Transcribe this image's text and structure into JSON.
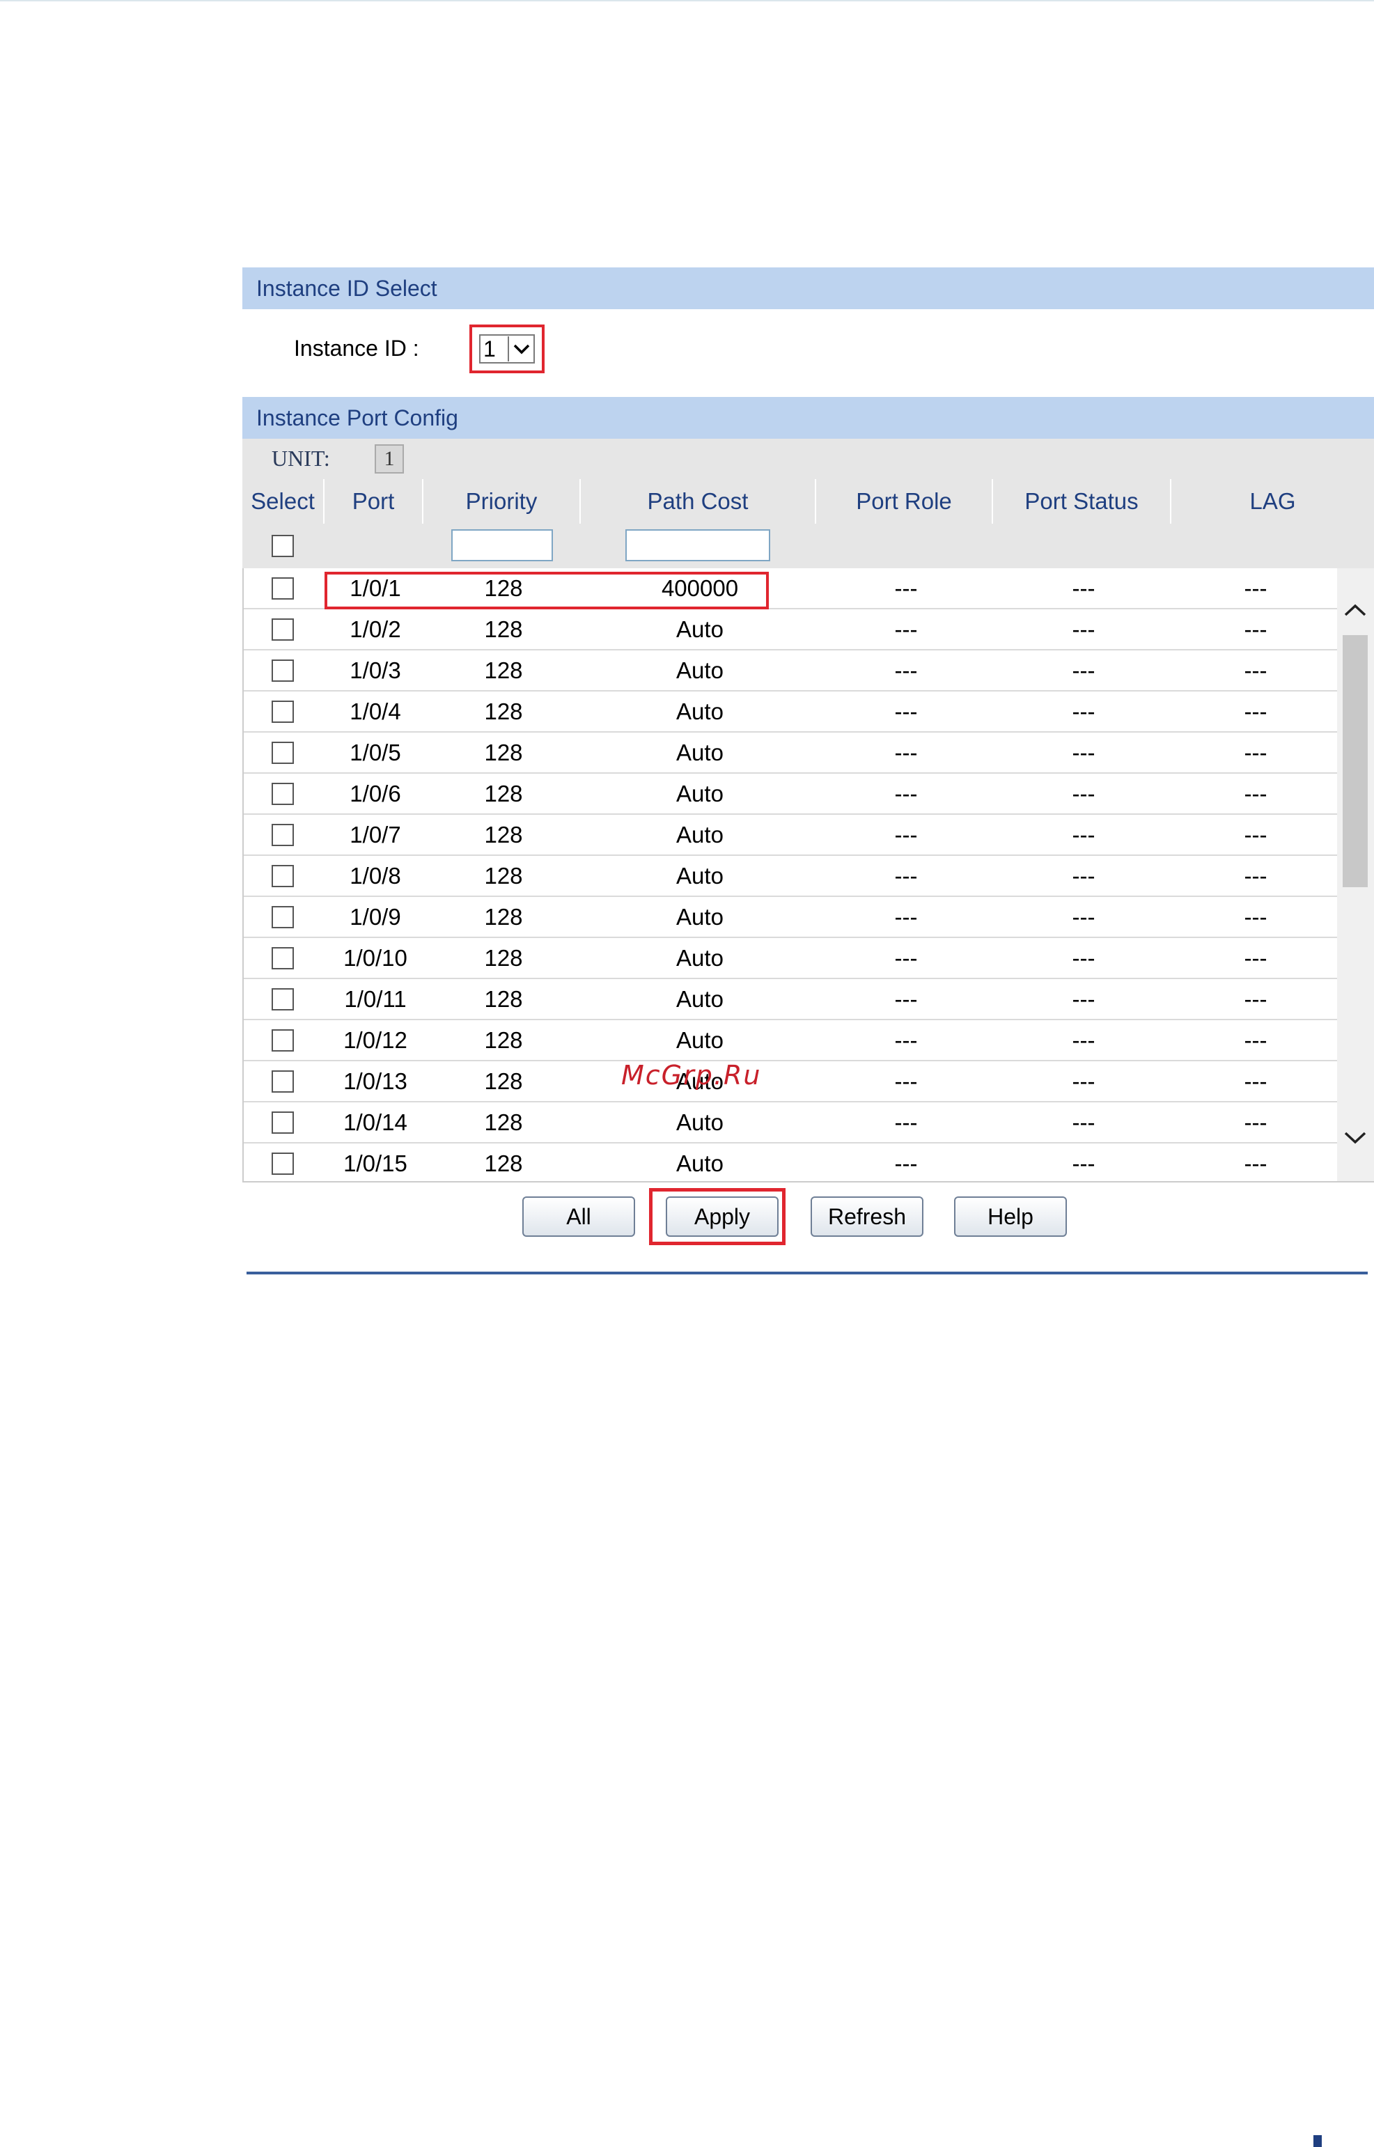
{
  "sections": {
    "instance_id_select": "Instance ID Select",
    "instance_port_config": "Instance Port Config"
  },
  "instance": {
    "label": "Instance ID :",
    "value": "1"
  },
  "unit": {
    "label": "UNIT:",
    "value": "1"
  },
  "columns": [
    "Select",
    "Port",
    "Priority",
    "Path Cost",
    "Port Role",
    "Port Status",
    "LAG"
  ],
  "rows": [
    {
      "port": "1/0/1",
      "priority": "128",
      "path_cost": "400000",
      "role": "---",
      "status": "---",
      "lag": "---"
    },
    {
      "port": "1/0/2",
      "priority": "128",
      "path_cost": "Auto",
      "role": "---",
      "status": "---",
      "lag": "---"
    },
    {
      "port": "1/0/3",
      "priority": "128",
      "path_cost": "Auto",
      "role": "---",
      "status": "---",
      "lag": "---"
    },
    {
      "port": "1/0/4",
      "priority": "128",
      "path_cost": "Auto",
      "role": "---",
      "status": "---",
      "lag": "---"
    },
    {
      "port": "1/0/5",
      "priority": "128",
      "path_cost": "Auto",
      "role": "---",
      "status": "---",
      "lag": "---"
    },
    {
      "port": "1/0/6",
      "priority": "128",
      "path_cost": "Auto",
      "role": "---",
      "status": "---",
      "lag": "---"
    },
    {
      "port": "1/0/7",
      "priority": "128",
      "path_cost": "Auto",
      "role": "---",
      "status": "---",
      "lag": "---"
    },
    {
      "port": "1/0/8",
      "priority": "128",
      "path_cost": "Auto",
      "role": "---",
      "status": "---",
      "lag": "---"
    },
    {
      "port": "1/0/9",
      "priority": "128",
      "path_cost": "Auto",
      "role": "---",
      "status": "---",
      "lag": "---"
    },
    {
      "port": "1/0/10",
      "priority": "128",
      "path_cost": "Auto",
      "role": "---",
      "status": "---",
      "lag": "---"
    },
    {
      "port": "1/0/11",
      "priority": "128",
      "path_cost": "Auto",
      "role": "---",
      "status": "---",
      "lag": "---"
    },
    {
      "port": "1/0/12",
      "priority": "128",
      "path_cost": "Auto",
      "role": "---",
      "status": "---",
      "lag": "---"
    },
    {
      "port": "1/0/13",
      "priority": "128",
      "path_cost": "Auto",
      "role": "---",
      "status": "---",
      "lag": "---"
    },
    {
      "port": "1/0/14",
      "priority": "128",
      "path_cost": "Auto",
      "role": "---",
      "status": "---",
      "lag": "---"
    },
    {
      "port": "1/0/15",
      "priority": "128",
      "path_cost": "Auto",
      "role": "---",
      "status": "---",
      "lag": "---"
    }
  ],
  "buttons": {
    "all": "All",
    "apply": "Apply",
    "refresh": "Refresh",
    "help": "Help"
  },
  "watermark": "McGrp.Ru",
  "colors": {
    "section_bar": "#bdd3ef",
    "section_text": "#1f3f80",
    "highlight": "#e0262f"
  }
}
